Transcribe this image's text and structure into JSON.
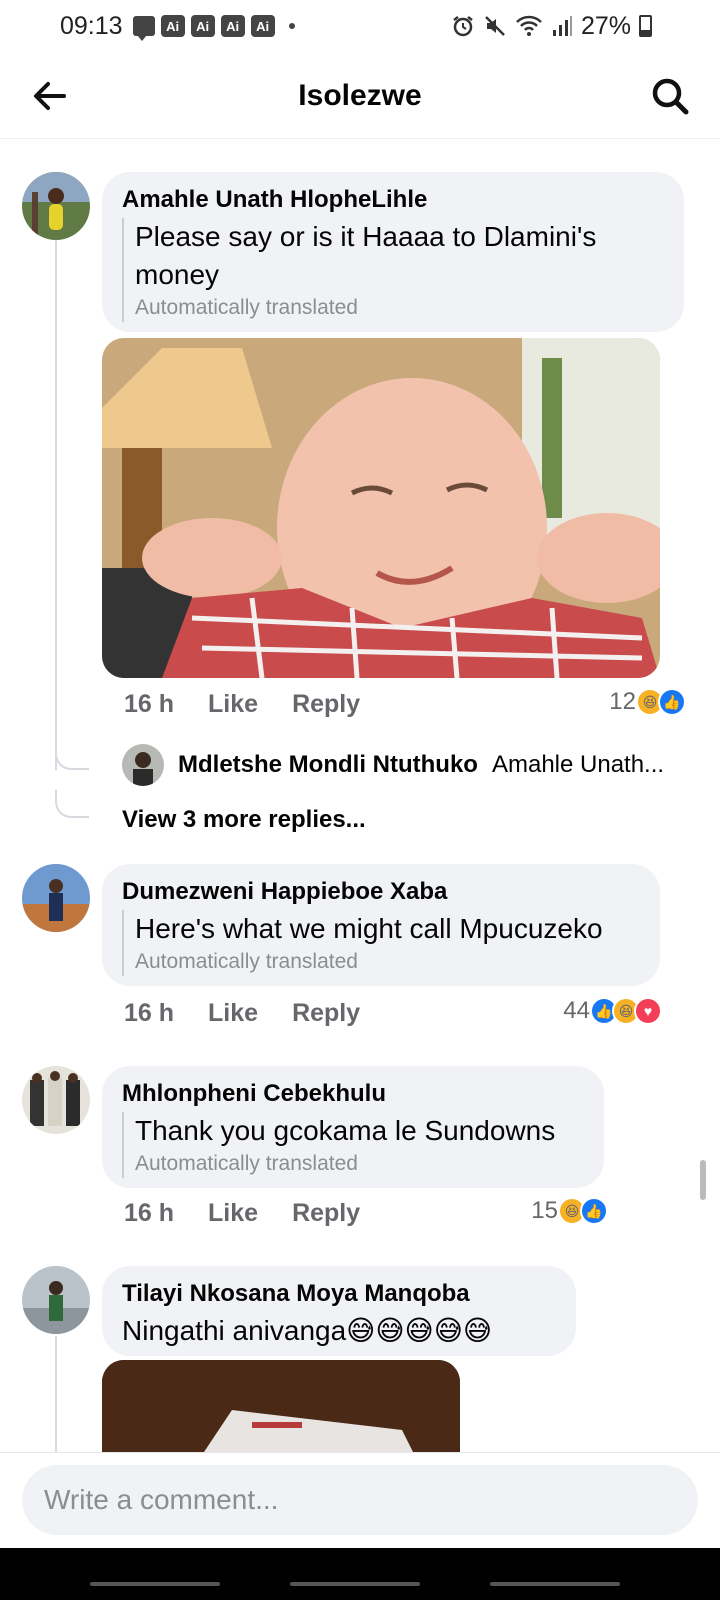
{
  "status_bar": {
    "time": "09:13",
    "badges": [
      "Ai",
      "Ai",
      "Ai",
      "Ai"
    ],
    "battery": "27%"
  },
  "header": {
    "title": "Isolezwe"
  },
  "comments": [
    {
      "author": "Amahle Unath HlopheLihle",
      "text": "Please say or is it Haaaa to Dlamini's money",
      "translated_label": "Automatically translated",
      "time": "16 h",
      "like_label": "Like",
      "reply_label": "Reply",
      "reaction_count": "12",
      "reactions": [
        "haha",
        "like"
      ],
      "replies": {
        "author": "Mdletshe Mondli Ntuthuko",
        "preview": "Amahle Unath...",
        "view_more": "View 3 more replies..."
      }
    },
    {
      "author": "Dumezweni Happieboe Xaba",
      "text": "Here's what we might call Mpucuzeko",
      "translated_label": "Automatically translated",
      "time": "16 h",
      "like_label": "Like",
      "reply_label": "Reply",
      "reaction_count": "44",
      "reactions": [
        "like",
        "haha",
        "love"
      ]
    },
    {
      "author": "Mhlonpheni Cebekhulu",
      "text": "Thank you gcokama le Sundowns",
      "translated_label": "Automatically translated",
      "time": "16 h",
      "like_label": "Like",
      "reply_label": "Reply",
      "reaction_count": "15",
      "reactions": [
        "haha",
        "like"
      ]
    },
    {
      "author": "Tilayi Nkosana Moya Manqoba",
      "text": "Ningathi anivanga😅😅😅😅😅"
    }
  ],
  "compose": {
    "placeholder": "Write a comment..."
  },
  "colors": {
    "bubble": "#f0f2f5",
    "meta": "#65676b",
    "like_blue": "#1877f2",
    "haha_yellow": "#f7b125",
    "love_red": "#f33e58"
  }
}
